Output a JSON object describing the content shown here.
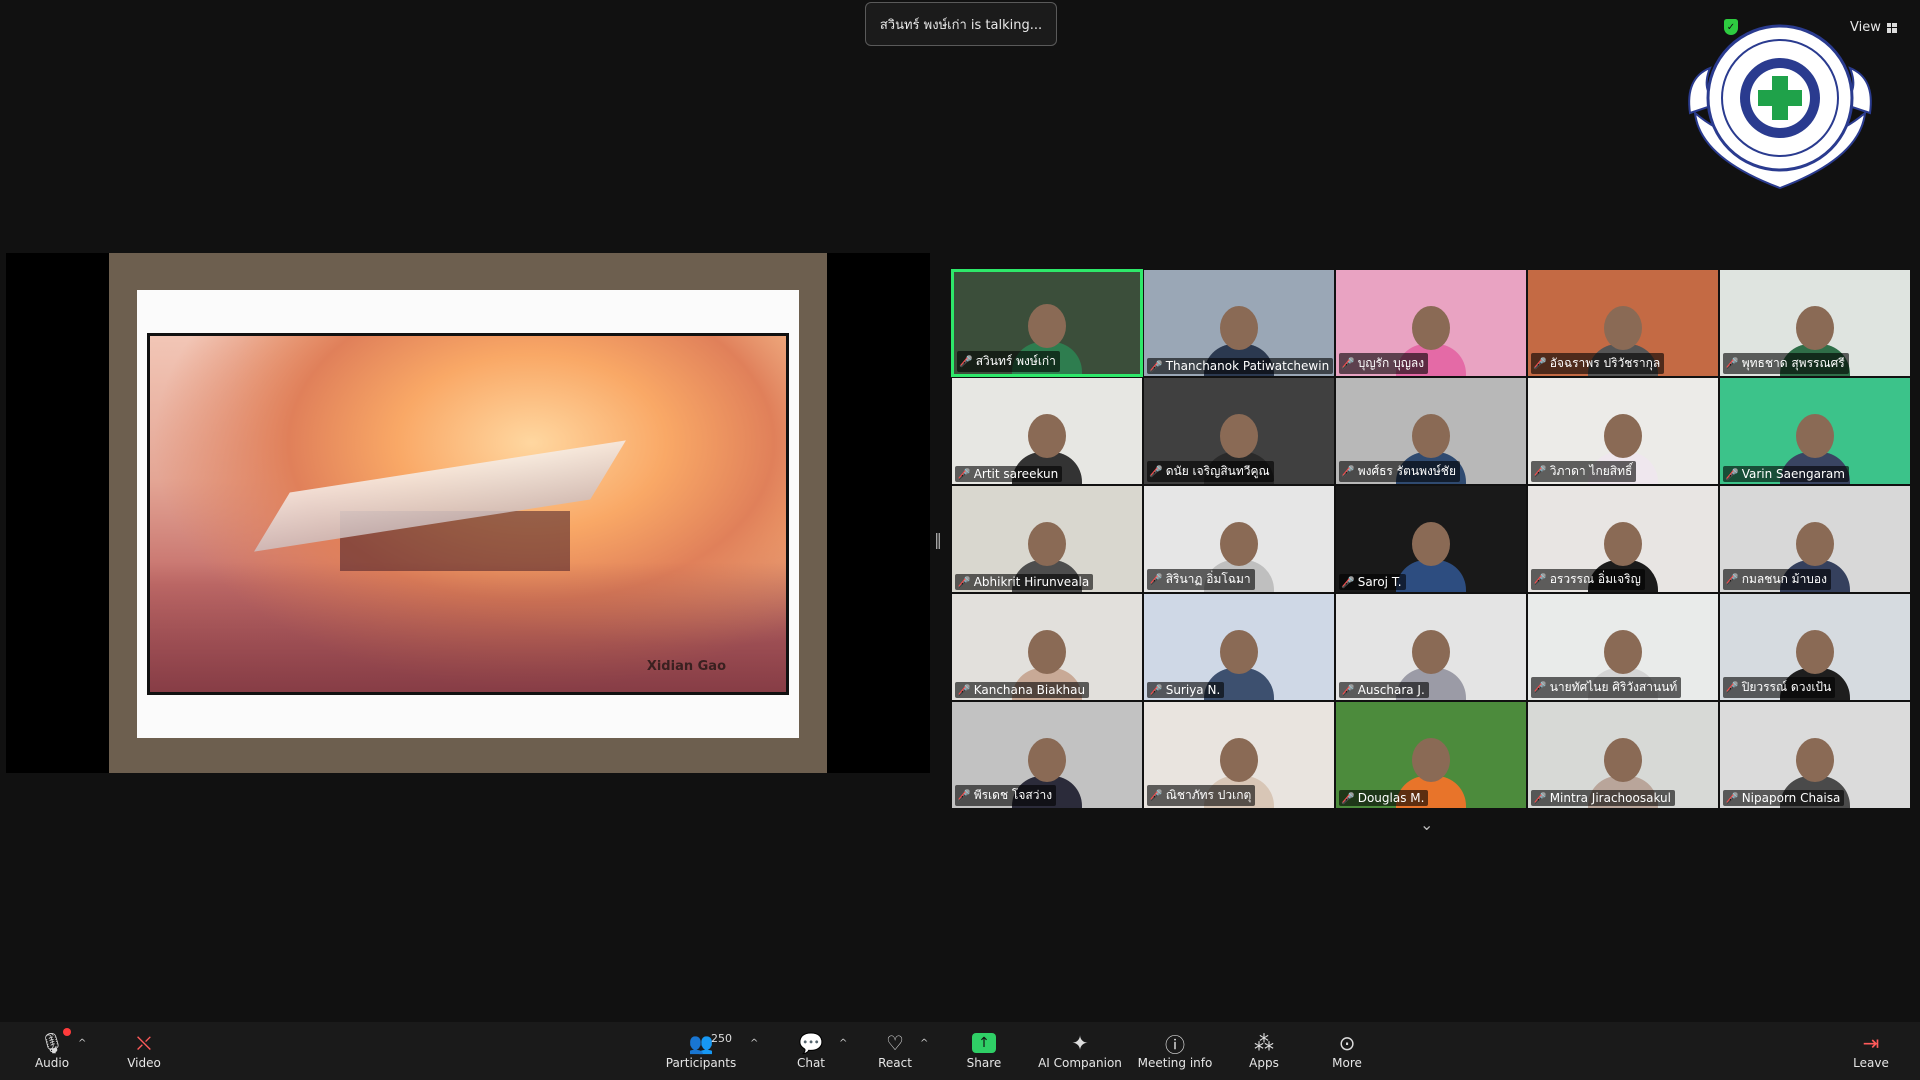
{
  "banner": {
    "talking_text": "สวินทร์  พงษ์เก่า is talking..."
  },
  "topbar": {
    "view_label": "View"
  },
  "share": {
    "watermark": "Xidian Gao"
  },
  "gallery": {
    "tiles": [
      {
        "name": "สวินทร์  พงษ์เก่า",
        "bg": "#3b4e3a",
        "shirt": "#2e7d4f",
        "active": true
      },
      {
        "name": "Thanchanok Patiwatchewin",
        "bg": "#9aa7b6",
        "shirt": "#2b3950",
        "active": false
      },
      {
        "name": "บุญรัก บุญลง",
        "bg": "#e9a3c2",
        "shirt": "#e46aa6",
        "active": false
      },
      {
        "name": "อัจฉราพร ปริวัชรากุล",
        "bg": "#c46a44",
        "shirt": "#555555",
        "active": false
      },
      {
        "name": "พุทธชาด สุพรรณศรี",
        "bg": "#dfe4e0",
        "shirt": "#2f6e48",
        "active": false
      },
      {
        "name": "Artit  sareekun",
        "bg": "#e7e7e3",
        "shirt": "#333333",
        "active": false
      },
      {
        "name": "ดนัย เจริญสินทวีคูณ",
        "bg": "#404040",
        "shirt": "#2a2a2a",
        "active": false
      },
      {
        "name": "พงศ์ธร รัตนพงษ์ชัย",
        "bg": "#b8b8b8",
        "shirt": "#2f4a70",
        "active": false
      },
      {
        "name": "วิภาดา ไกยสิทธิ์",
        "bg": "#ecebe8",
        "shirt": "#efe7ee",
        "active": false
      },
      {
        "name": "Varin Saengaram",
        "bg": "#3cc38a",
        "shirt": "#3a4562",
        "active": false
      },
      {
        "name": "Abhikrit Hirunveala",
        "bg": "#d9d7cf",
        "shirt": "#4d4d4d",
        "active": false
      },
      {
        "name": "สิรินาฏ อิ่มโฉมา",
        "bg": "#e6e6e6",
        "shirt": "#bfbfbf",
        "active": false
      },
      {
        "name": "Saroj T.",
        "bg": "#191919",
        "shirt": "#2d4d80",
        "active": false
      },
      {
        "name": "อรวรรณ อิ่มเจริญ",
        "bg": "#e8e5e3",
        "shirt": "#1b1b1b",
        "active": false
      },
      {
        "name": "กมลชนก ม้าบอง",
        "bg": "#d8d8d8",
        "shirt": "#35405d",
        "active": false
      },
      {
        "name": "Kanchana Biakhau",
        "bg": "#e2e0dc",
        "shirt": "#c8a996",
        "active": false
      },
      {
        "name": "Suriya N.",
        "bg": "#cfd8e6",
        "shirt": "#3d506f",
        "active": false
      },
      {
        "name": "Auschara J.",
        "bg": "#e4e4e4",
        "shirt": "#9b9ba6",
        "active": false
      },
      {
        "name": "นายทัศไนย ศิริวังสานนท์",
        "bg": "#e9ebea",
        "shirt": "#d4d4d4",
        "active": false
      },
      {
        "name": "ปิยวรรณ์ ดวงเป้น",
        "bg": "#d6dbe0",
        "shirt": "#1e1e1e",
        "active": false
      },
      {
        "name": "พีรเดช  โจสว่าง",
        "bg": "#c2c2c2",
        "shirt": "#2b2b3a",
        "active": false
      },
      {
        "name": "ณิชาภัทร ปวเกตุ",
        "bg": "#e9e4df",
        "shirt": "#d8c6b6",
        "active": false
      },
      {
        "name": "Douglas M.",
        "bg": "#4c8b3c",
        "shirt": "#e8742a",
        "active": false
      },
      {
        "name": "Mintra Jirachoosakul",
        "bg": "#d7d9d6",
        "shirt": "#b9a59a",
        "active": false
      },
      {
        "name": "Nipaporn Chaisa",
        "bg": "#dbdbdb",
        "shirt": "#4a4a4a",
        "active": false
      }
    ]
  },
  "toolbar": {
    "audio": "Audio",
    "video": "Video",
    "participants": "Participants",
    "participants_count": "250",
    "chat": "Chat",
    "react": "React",
    "share": "Share",
    "ai": "AI Companion",
    "info": "Meeting info",
    "apps": "Apps",
    "more": "More",
    "leave": "Leave"
  },
  "icons": {
    "audio": "microphone-icon",
    "video": "camera-off-icon",
    "participants": "people-icon",
    "chat": "chat-bubble-icon",
    "react": "heart-icon",
    "share": "share-arrow-icon",
    "ai": "sparkle-icon",
    "info": "info-icon",
    "apps": "apps-icon",
    "more": "ellipsis-icon",
    "leave": "leave-icon"
  },
  "colors": {
    "active_speaker": "#2ee86a",
    "share_green": "#2fcf66",
    "mute_red": "#ff4b4b"
  }
}
